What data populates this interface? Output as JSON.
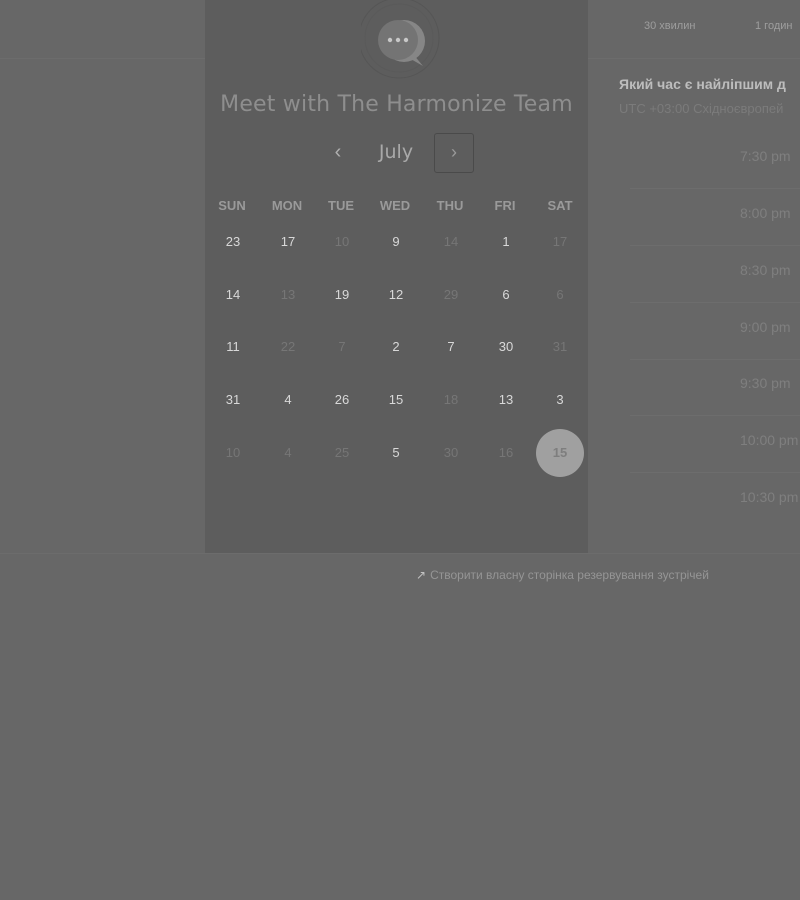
{
  "calendar": {
    "title": "Meet with The Harmonize Team",
    "month": "July",
    "weekdays": [
      "SUN",
      "MON",
      "TUE",
      "WED",
      "THU",
      "FRI",
      "SAT"
    ],
    "weeks": [
      [
        {
          "label": "23",
          "muted": false
        },
        {
          "label": "17",
          "muted": false
        },
        {
          "label": "10",
          "muted": true
        },
        {
          "label": "9",
          "muted": false
        },
        {
          "label": "14",
          "muted": true
        },
        {
          "label": "1",
          "muted": false
        },
        {
          "label": "17",
          "muted": true
        }
      ],
      [
        {
          "label": "14",
          "muted": false
        },
        {
          "label": "13",
          "muted": true
        },
        {
          "label": "19",
          "muted": false
        },
        {
          "label": "12",
          "muted": false
        },
        {
          "label": "29",
          "muted": true
        },
        {
          "label": "6",
          "muted": false
        },
        {
          "label": "6",
          "muted": true
        }
      ],
      [
        {
          "label": "11",
          "muted": false
        },
        {
          "label": "22",
          "muted": true
        },
        {
          "label": "7",
          "muted": true
        },
        {
          "label": "2",
          "muted": false
        },
        {
          "label": "7",
          "muted": false
        },
        {
          "label": "30",
          "muted": false
        },
        {
          "label": "31",
          "muted": true
        }
      ],
      [
        {
          "label": "31",
          "muted": false
        },
        {
          "label": "4",
          "muted": false
        },
        {
          "label": "26",
          "muted": false
        },
        {
          "label": "15",
          "muted": false
        },
        {
          "label": "18",
          "muted": true
        },
        {
          "label": "13",
          "muted": false
        },
        {
          "label": "3",
          "muted": false
        }
      ],
      [
        {
          "label": "10",
          "muted": true
        },
        {
          "label": "4",
          "muted": true
        },
        {
          "label": "25",
          "muted": true
        },
        {
          "label": "5",
          "muted": false
        },
        {
          "label": "30",
          "muted": true
        },
        {
          "label": "16",
          "muted": true
        },
        {
          "label": "15",
          "muted": false,
          "selected": true
        }
      ]
    ],
    "prev_icon": "chevron-left-icon",
    "next_icon": "chevron-right-icon",
    "logo_icon": "chat-bubble-icon"
  },
  "booking": {
    "durations": [
      "30 хвилин",
      "1 годин"
    ],
    "question": "Який час є найліпшим д",
    "timezone": "UTC +03:00 Східноєвропей",
    "slots": [
      "7:30 pm",
      "8:00 pm",
      "8:30 pm",
      "9:00 pm",
      "9:30 pm",
      "10:00 pm",
      "10:30 pm"
    ]
  },
  "footer": {
    "link_icon": "sparkle-icon",
    "link_text": "Створити власну сторінка резервування зустрічей"
  },
  "colors": {
    "overlay": "#676767",
    "card": "#5d5d5d",
    "selected_day": "#a0a0a0"
  }
}
